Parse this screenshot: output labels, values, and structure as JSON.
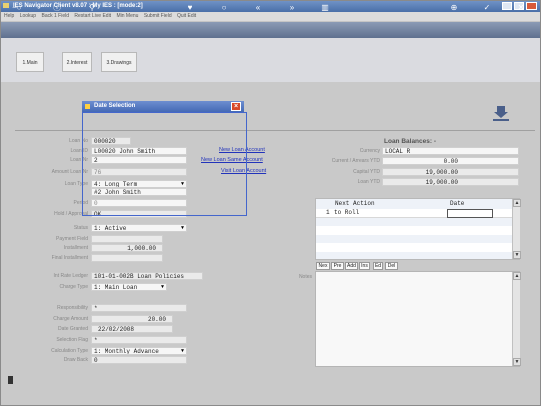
{
  "window": {
    "title": "IES Navigator Client v8.07 : My IES :      [mode:2]"
  },
  "menu": [
    "Help",
    "Lookup",
    "Back 1 Field",
    "Restart Live Edit",
    "Min Menu",
    "Submit Field",
    "Quit Edit"
  ],
  "toolbar": {
    "icons": [
      "key-icon",
      "info-icon",
      "search-icon",
      "heart-icon",
      "circle-icon",
      "rewind-icon",
      "fast-forward-icon",
      "chart-icon",
      "plus-icon",
      "check-icon",
      "close-icon"
    ]
  },
  "tabs": [
    {
      "label": "1.Main"
    },
    {
      "label": "2.Interest"
    },
    {
      "label": "3.Drawings"
    }
  ],
  "dialog": {
    "title": "Date Selection"
  },
  "form": {
    "loan_no": {
      "label": "Loan No",
      "value": "000020"
    },
    "loan_id": {
      "label": "Loan ID",
      "value": "L00020 John Smith"
    },
    "loan_nr": {
      "label": "Loan Nr",
      "value": "2"
    },
    "amount_loan_nr": {
      "label": "Amount Loan Nr",
      "value": "76"
    },
    "loan_type": {
      "label": "Loan Type",
      "value": "4: Long Term"
    },
    "name": {
      "label": "Name",
      "value": "#2 John Smith"
    },
    "period": {
      "label": "Period",
      "value": "0"
    },
    "flag": {
      "label": "Hold / Approval",
      "value": "OK"
    },
    "status": {
      "label": "Status",
      "value": "1: Active"
    },
    "payment_field": {
      "label": "Payment Field",
      "value": ""
    },
    "installment": {
      "label": "Installment",
      "value": "1,000.00"
    },
    "final_installment": {
      "label": "Final Installment",
      "value": ""
    },
    "gl_rate_ledger": {
      "label": "Int Rate Ledger",
      "value": "101-01-002B Loan Policies"
    },
    "charge_type": {
      "label": "Charge Type",
      "value": "1: Main Loan"
    },
    "responsibility": {
      "label": "Responsibility",
      "value": "*"
    },
    "charge_amount": {
      "label": "Charge Amount",
      "value": "20.00"
    },
    "date_granted": {
      "label": "Date Granted",
      "value": "22/02/2008"
    },
    "selection_flag": {
      "label": "Selection Flag",
      "value": "*"
    },
    "calculation_type": {
      "label": "Calculation Type",
      "value": "1: Monthly Advance"
    },
    "draw_back": {
      "label": "Draw Back",
      "value": "0"
    }
  },
  "links": {
    "new_loan_account": "New Loan Account",
    "new_loan_same_account": "New Loan Same Account",
    "visit_loan_account": "Visit Loan Account"
  },
  "balances": {
    "title": "Loan Balances: -",
    "rows": [
      {
        "label": "Currency",
        "value": "LOCAL R"
      },
      {
        "label": "Current / Arrears YTD",
        "value": "0.00"
      },
      {
        "label": "Capital YTD",
        "value": "19,000.00"
      },
      {
        "label": "Loan YTD",
        "value": "19,000.00"
      }
    ]
  },
  "actions_grid": {
    "col_next_action": "Next Action",
    "col_date": "Date",
    "rows": [
      {
        "num": "1",
        "action": "to Roll",
        "date": ""
      }
    ]
  },
  "grid_buttons": [
    "Nex",
    "Pre",
    "Add",
    "Ins",
    "Ed",
    "Del"
  ],
  "notes": {
    "label": "Notes"
  },
  "colors": {
    "titlebar": "#4a6fa8",
    "toolbar": "#5f708f",
    "dialog_border": "#4466cc",
    "link": "#2233bb"
  }
}
